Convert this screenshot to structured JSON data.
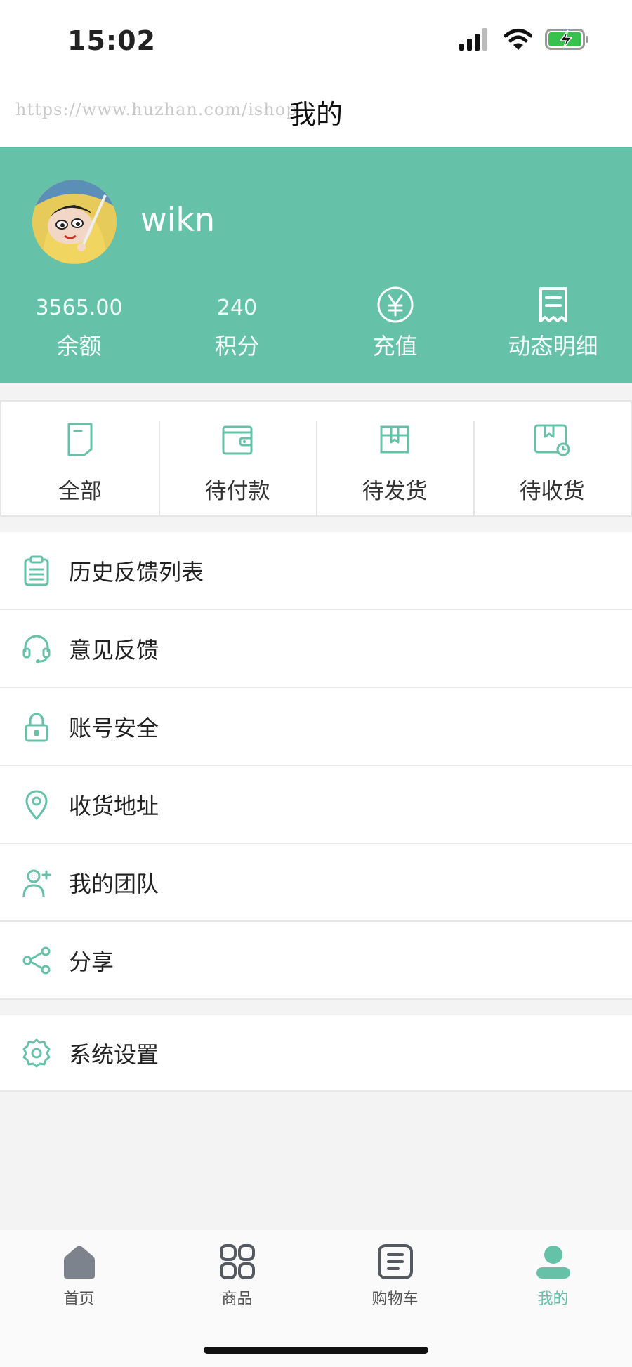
{
  "status_bar": {
    "time": "15:02",
    "icons": [
      "signal-icon",
      "wifi-icon",
      "battery-charging-icon"
    ]
  },
  "header": {
    "watermark": "https://www.huzhan.com/ishop",
    "title": "我的"
  },
  "profile": {
    "username": "wikn",
    "stats": [
      {
        "value": "3565.00",
        "label": "余额"
      },
      {
        "value": "240",
        "label": "积分"
      },
      {
        "icon": "yen-icon",
        "label": "充值"
      },
      {
        "icon": "receipt-icon",
        "label": "动态明细"
      }
    ]
  },
  "orders": [
    {
      "icon": "document-icon",
      "label": "全部"
    },
    {
      "icon": "wallet-icon",
      "label": "待付款"
    },
    {
      "icon": "package-icon",
      "label": "待发货"
    },
    {
      "icon": "delivery-box-icon",
      "label": "待收货"
    }
  ],
  "menu": [
    {
      "icon": "clipboard-icon",
      "label": "历史反馈列表"
    },
    {
      "icon": "headset-icon",
      "label": "意见反馈"
    },
    {
      "icon": "lock-icon",
      "label": "账号安全"
    },
    {
      "icon": "location-pin-icon",
      "label": "收货地址"
    },
    {
      "icon": "add-user-icon",
      "label": "我的团队"
    },
    {
      "icon": "share-icon",
      "label": "分享"
    }
  ],
  "settings": {
    "icon": "gear-icon",
    "label": "系统设置"
  },
  "tabbar": [
    {
      "icon": "home-icon",
      "label": "首页",
      "active": false
    },
    {
      "icon": "grid-icon",
      "label": "商品",
      "active": false
    },
    {
      "icon": "cart-list-icon",
      "label": "购物车",
      "active": false
    },
    {
      "icon": "user-icon",
      "label": "我的",
      "active": true
    }
  ],
  "colors": {
    "accent": "#65c2a8",
    "background": "#f3f3f3",
    "text": "#222222",
    "tab_inactive": "#7d838c"
  }
}
